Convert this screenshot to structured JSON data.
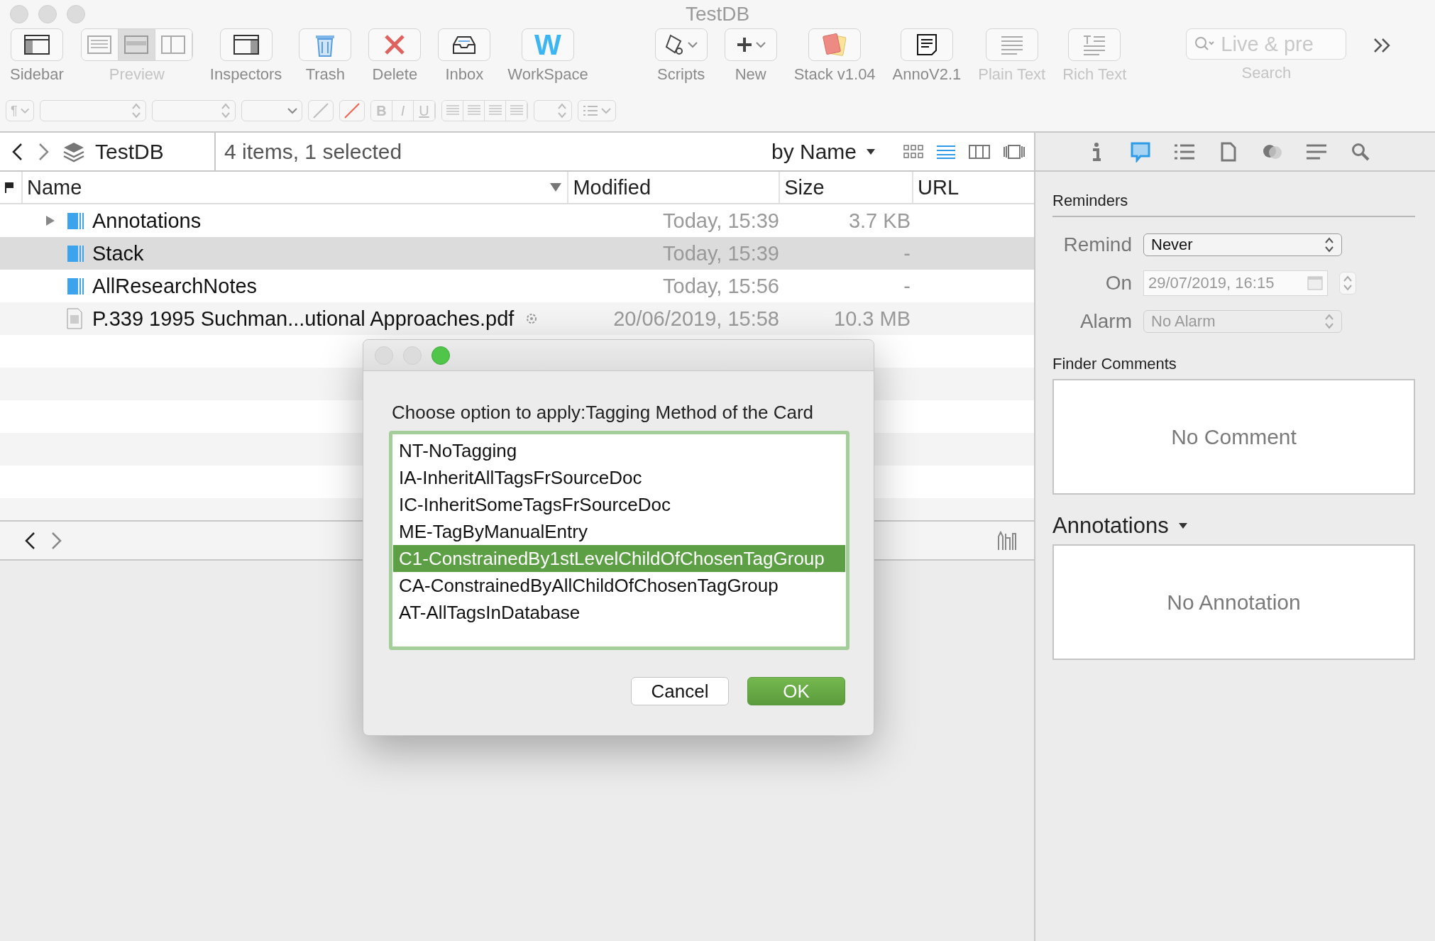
{
  "window": {
    "title": "TestDB"
  },
  "toolbar": {
    "items": [
      {
        "label": "Sidebar",
        "disabled": false,
        "kind": "button"
      },
      {
        "label": "Preview",
        "disabled": true,
        "kind": "segmented",
        "segments": [
          {
            "selected": false
          },
          {
            "selected": true
          },
          {
            "selected": false
          }
        ]
      },
      {
        "label": "Inspectors",
        "disabled": false,
        "kind": "button"
      },
      {
        "label": "Trash",
        "disabled": false,
        "kind": "button"
      },
      {
        "label": "Delete",
        "disabled": false,
        "kind": "button"
      },
      {
        "label": "Inbox",
        "disabled": false,
        "kind": "button"
      },
      {
        "label": "WorkSpace",
        "disabled": false,
        "kind": "glyph",
        "glyph": "W"
      },
      {
        "label": "Scripts",
        "disabled": false,
        "kind": "menu"
      },
      {
        "label": "New",
        "disabled": false,
        "kind": "menu"
      },
      {
        "label": "Stack v1.04",
        "disabled": false,
        "kind": "button"
      },
      {
        "label": "AnnoV2.1",
        "disabled": false,
        "kind": "button"
      },
      {
        "label": "Plain Text",
        "disabled": true,
        "kind": "button"
      },
      {
        "label": "Rich Text",
        "disabled": true,
        "kind": "button"
      }
    ],
    "search": {
      "placeholder": "Live & pre",
      "label": "Search"
    }
  },
  "format_bar": {
    "paragraph_glyph": "¶",
    "style_buttons": [
      "B",
      "I",
      "U"
    ]
  },
  "path_bar": {
    "location": "TestDB",
    "status": "4 items, 1 selected",
    "sort": "by Name",
    "views": [
      {
        "selected": false
      },
      {
        "selected": true
      },
      {
        "selected": false
      },
      {
        "selected": false
      }
    ]
  },
  "table": {
    "columns": [
      "Name",
      "Modified",
      "Size",
      "URL"
    ],
    "rows": [
      {
        "name": "Annotations",
        "kind": "group",
        "expandable": true,
        "selected": false,
        "modified": "Today, 15:39",
        "size": "3.7 KB"
      },
      {
        "name": "Stack",
        "kind": "group",
        "expandable": false,
        "selected": true,
        "modified": "Today, 15:39",
        "size": "-"
      },
      {
        "name": "AllResearchNotes",
        "kind": "group",
        "expandable": false,
        "selected": false,
        "modified": "Today, 15:56",
        "size": "-"
      },
      {
        "name": "P.339 1995 Suchman...utional Approaches.pdf",
        "kind": "pdf",
        "expandable": false,
        "selected": false,
        "modified": "20/06/2019, 15:58",
        "size": "10.3 MB"
      }
    ]
  },
  "inspector": {
    "tabs": [
      {
        "selected": false
      },
      {
        "selected": true
      },
      {
        "selected": false
      },
      {
        "selected": false
      },
      {
        "selected": false
      },
      {
        "selected": false
      },
      {
        "selected": false
      }
    ],
    "reminders": {
      "heading": "Reminders",
      "fields": [
        {
          "label": "Remind",
          "value": "Never",
          "kind": "popup",
          "disabled": false
        },
        {
          "label": "On",
          "value": "29/07/2019, 16:15",
          "kind": "date",
          "disabled": true
        },
        {
          "label": "Alarm",
          "value": "No Alarm",
          "kind": "popup",
          "disabled": true
        }
      ]
    },
    "finder_comments": {
      "heading": "Finder Comments",
      "placeholder": "No Comment"
    },
    "annotations": {
      "heading": "Annotations",
      "placeholder": "No Annotation"
    }
  },
  "dialog": {
    "prompt": "Choose option to apply:Tagging Method of the Card",
    "options": [
      {
        "label": "NT-NoTagging",
        "selected": false
      },
      {
        "label": "IA-InheritAllTagsFrSourceDoc",
        "selected": false
      },
      {
        "label": "IC-InheritSomeTagsFrSourceDoc",
        "selected": false
      },
      {
        "label": "ME-TagByManualEntry",
        "selected": false
      },
      {
        "label": "C1-ConstrainedBy1stLevelChildOfChosenTagGroup",
        "selected": true
      },
      {
        "label": "CA-ConstrainedByAllChildOfChosenTagGroup",
        "selected": false
      },
      {
        "label": "AT-AllTagsInDatabase",
        "selected": false
      }
    ],
    "buttons": [
      {
        "label": "Cancel",
        "default": false
      },
      {
        "label": "OK",
        "default": true
      }
    ]
  }
}
